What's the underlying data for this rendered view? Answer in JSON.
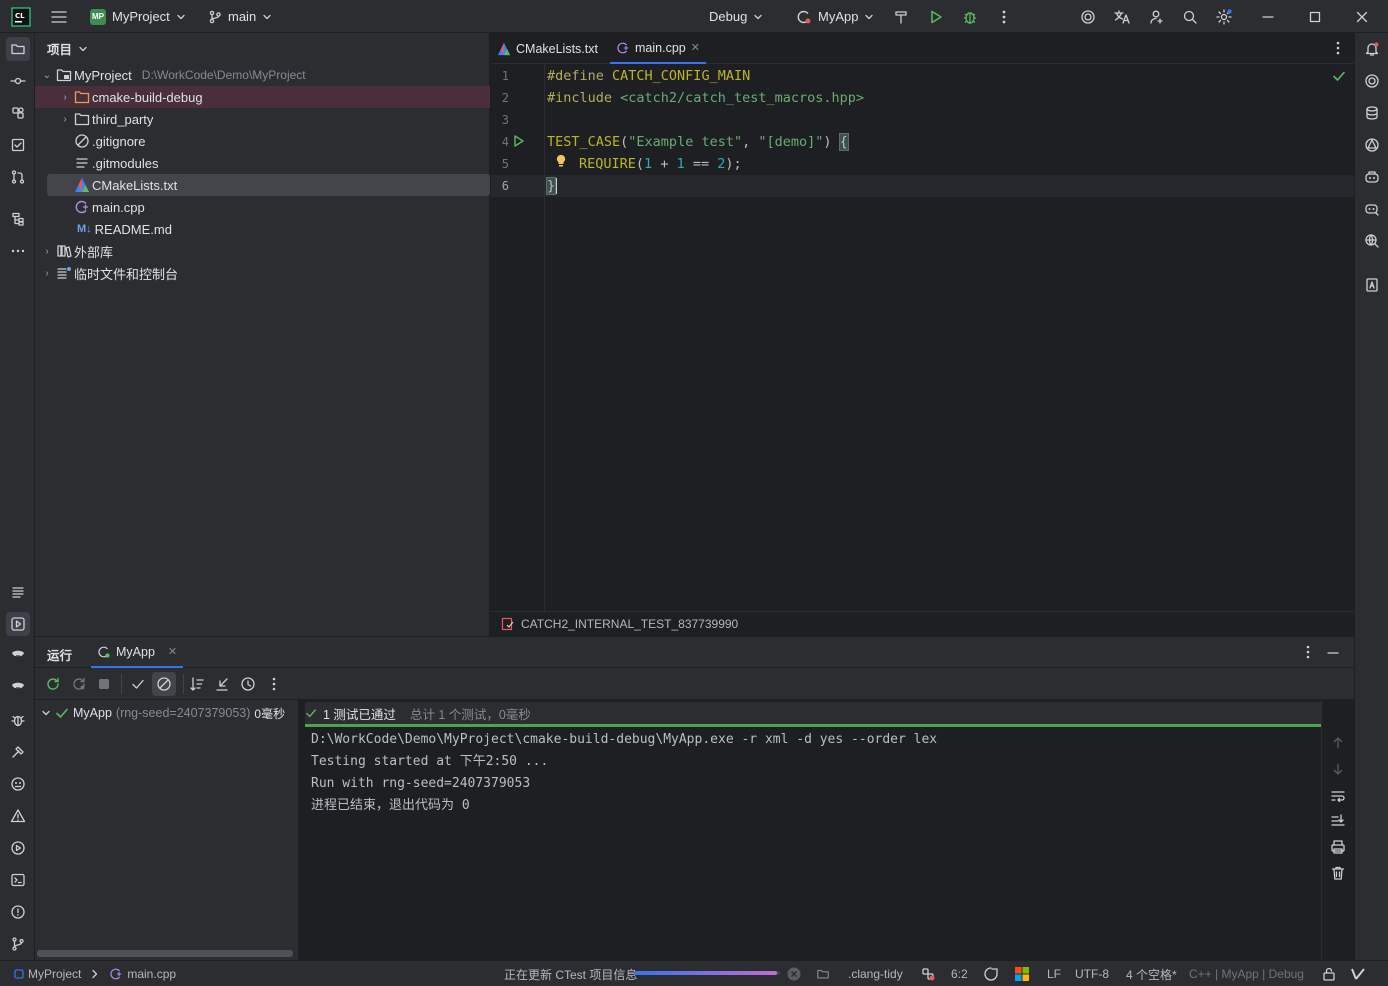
{
  "titlebar": {
    "project_badge": "MP",
    "project_name": "MyProject",
    "branch": "main",
    "run_config": "Debug",
    "target": "MyApp"
  },
  "project_panel": {
    "title": "项目",
    "root_name": "MyProject",
    "root_path": "D:\\WorkCode\\Demo\\MyProject",
    "items": [
      {
        "label": "cmake-build-debug",
        "icon": "folder-icon"
      },
      {
        "label": "third_party",
        "icon": "folder-icon"
      },
      {
        "label": ".gitignore",
        "icon": "ignore-file-icon"
      },
      {
        "label": ".gitmodules",
        "icon": "text-file-icon"
      },
      {
        "label": "CMakeLists.txt",
        "icon": "cmake-icon"
      },
      {
        "label": "main.cpp",
        "icon": "cpp-file-icon"
      },
      {
        "label": "README.md",
        "icon": "markdown-icon",
        "prefix": "M↓"
      },
      {
        "label": "外部库",
        "icon": "library-icon"
      },
      {
        "label": "临时文件和控制台",
        "icon": "scratches-icon"
      }
    ]
  },
  "editor": {
    "tabs": [
      {
        "label": "CMakeLists.txt"
      },
      {
        "label": "main.cpp"
      }
    ],
    "line_numbers": [
      "1",
      "2",
      "3",
      "4",
      "5",
      "6"
    ],
    "code": {
      "l1_kw": "#define",
      "l1_rest": " CATCH_CONFIG_MAIN",
      "l2_kw": "#include",
      "l2_rest": " <catch2/catch_test_macros.hpp>",
      "l4_fn": "TEST_CASE",
      "l4_p1": "(",
      "l4_s1": "\"Example test\"",
      "l4_c": ", ",
      "l4_s2": "\"[demo]\"",
      "l4_p2": ") ",
      "l4_brace": "{",
      "l5_fn": "REQUIRE",
      "l5_p1": "(",
      "l5_n1": "1",
      "l5_op1": " + ",
      "l5_n2": "1",
      "l5_op2": " == ",
      "l5_n3": "2",
      "l5_p2": ");",
      "l6_brace": "}"
    },
    "breadcrumb": "CATCH2_INTERNAL_TEST_837739990"
  },
  "run_panel": {
    "tab_run": "运行",
    "tab_app": "MyApp",
    "tree_item": "MyApp",
    "tree_seed": "(rng-seed=2407379053)",
    "tree_time": "0毫秒",
    "summary_passed": "1 测试已通过",
    "summary_total": "总计 1 个测试，0毫秒",
    "console_lines": [
      "D:\\WorkCode\\Demo\\MyProject\\cmake-build-debug\\MyApp.exe -r xml -d yes --order lex",
      "Testing started at 下午2:50 ...",
      "Run with rng-seed=2407379053",
      "进程已结束，退出代码为 0"
    ]
  },
  "statusbar": {
    "crumb_project": "MyProject",
    "crumb_file": "main.cpp",
    "task": "正在更新 CTest 项目信息",
    "task_progress": 0.98,
    "clang_tidy": ".clang-tidy",
    "position": "6:2",
    "line_ending": "LF",
    "encoding": "UTF-8",
    "indent": "4 个空格*",
    "context": "C++ | MyApp | Debug"
  }
}
